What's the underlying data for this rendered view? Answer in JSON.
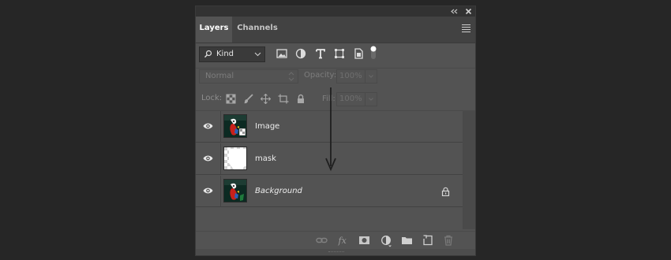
{
  "panel": {
    "collapse_icon": "double-chevron-left",
    "close_icon": "close-x"
  },
  "tabs": [
    {
      "label": "Layers",
      "active": true
    },
    {
      "label": "Channels",
      "active": false
    }
  ],
  "filter": {
    "kind_label": "Kind",
    "filter_icons": [
      "image-filter-icon",
      "adjustment-filter-icon",
      "type-filter-icon",
      "shape-filter-icon",
      "smart-object-filter-icon",
      "filter-toggle-icon"
    ]
  },
  "blend": {
    "mode": "Normal",
    "opacity_label": "Opacity:",
    "opacity_value": "100%",
    "fill_label": "Fill:",
    "fill_value": "100%"
  },
  "lock": {
    "label": "Lock:",
    "icons": [
      "lock-transparent-pixels-icon",
      "lock-image-pixels-icon",
      "lock-position-icon",
      "lock-artboard-icon",
      "lock-all-icon"
    ]
  },
  "layers": [
    {
      "name": "Image",
      "visible": true,
      "italic": false,
      "locked": false,
      "thumb": "parrot-with-mask-badge"
    },
    {
      "name": "mask",
      "visible": true,
      "italic": false,
      "locked": false,
      "thumb": "transparent-checkerboard"
    },
    {
      "name": "Background",
      "visible": true,
      "italic": true,
      "locked": true,
      "thumb": "parrot"
    }
  ],
  "footer_icons": [
    "link-layers-icon",
    "fx-icon",
    "add-mask-icon",
    "new-adjustment-icon",
    "new-group-icon",
    "new-layer-icon",
    "delete-layer-icon"
  ],
  "colors": {
    "background": "#262626",
    "panel": "#535353",
    "tab_strip": "#424242",
    "text": "#d6d6d6",
    "dim_text": "#7d7d7d"
  }
}
